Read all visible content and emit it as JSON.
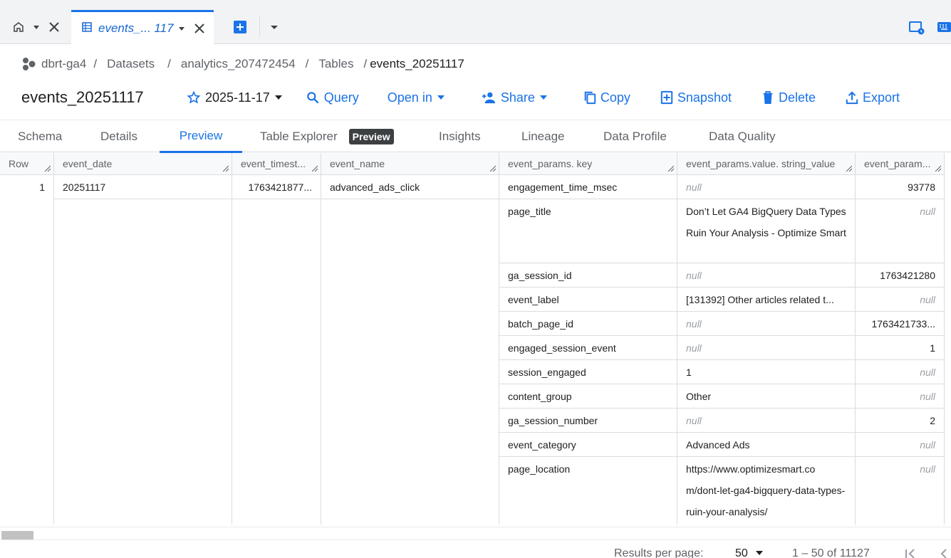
{
  "tabs": {
    "active_tab_title": "events_... 117"
  },
  "breadcrumb": {
    "project": "dbrt-ga4",
    "datasets": "Datasets",
    "dataset": "analytics_207472454",
    "tables": "Tables",
    "current": "events_20251117",
    "separator": "/"
  },
  "page_title": "events_20251117",
  "toolbar": {
    "date_label": "2025-11-17",
    "query_label": "Query",
    "open_in_label": "Open in",
    "share_label": "Share",
    "copy_label": "Copy",
    "snapshot_label": "Snapshot",
    "delete_label": "Delete",
    "export_label": "Export"
  },
  "subtabs": [
    {
      "label": "Schema"
    },
    {
      "label": "Details"
    },
    {
      "label": "Preview"
    },
    {
      "label": "Table Explorer"
    },
    {
      "label": "Insights"
    },
    {
      "label": "Lineage"
    },
    {
      "label": "Data Profile"
    },
    {
      "label": "Data Quality"
    }
  ],
  "preview_badge": "Preview",
  "columns": [
    "Row",
    "event_date",
    "event_timest...",
    "event_name",
    "event_params. key",
    "event_params.value. string_value",
    "event_param..."
  ],
  "row": {
    "row_number": "1",
    "event_date": "20251117",
    "event_timestamp": "1763421877...",
    "event_name": "advanced_ads_click"
  },
  "params": [
    {
      "key": "engagement_time_msec",
      "string_value": "null",
      "int_value": "93778"
    },
    {
      "key": "page_title",
      "string_value": "Don’t Let GA4 BigQuery Data Types Ruin Your Analysis - Optimize Smart",
      "int_value": "null"
    },
    {
      "key": "ga_session_id",
      "string_value": "null",
      "int_value": "1763421280"
    },
    {
      "key": "event_label",
      "string_value": "[131392] Other articles related t...",
      "int_value": "null"
    },
    {
      "key": "batch_page_id",
      "string_value": "null",
      "int_value": "1763421733..."
    },
    {
      "key": "engaged_session_event",
      "string_value": "null",
      "int_value": "1"
    },
    {
      "key": "session_engaged",
      "string_value": "1",
      "int_value": "null"
    },
    {
      "key": "content_group",
      "string_value": "Other",
      "int_value": "null"
    },
    {
      "key": "ga_session_number",
      "string_value": "null",
      "int_value": "2"
    },
    {
      "key": "event_category",
      "string_value": "Advanced Ads",
      "int_value": "null"
    },
    {
      "key": "page_location",
      "string_value": "https://www.optimizesmart.co m/dont-let-ga4-bigquery-data-types-ruin-your-analysis/",
      "int_value": "null"
    }
  ],
  "footer": {
    "results_per_page_label": "Results per page:",
    "results_per_page_value": "50",
    "range_label": "1 – 50 of 11127"
  },
  "colors": {
    "accent": "#1a73e8",
    "badge_bg": "#3c4043",
    "null_text": "#9aa0a6"
  }
}
